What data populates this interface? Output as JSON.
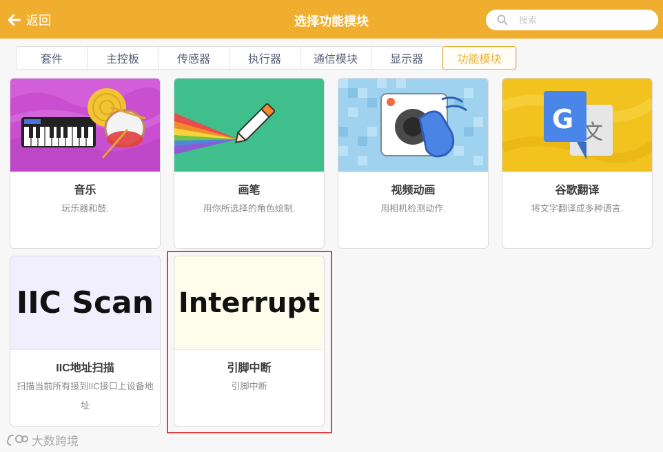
{
  "header": {
    "back_label": "返回",
    "title": "选择功能模块",
    "search_placeholder": "搜索"
  },
  "tabs": [
    {
      "label": "套件"
    },
    {
      "label": "主控板"
    },
    {
      "label": "传感器"
    },
    {
      "label": "执行器"
    },
    {
      "label": "通信模块"
    },
    {
      "label": "显示器"
    },
    {
      "label": "功能模块",
      "active": true
    }
  ],
  "cards": [
    {
      "name": "音乐",
      "desc": "玩乐器和鼓.",
      "icon": "music-piano-drum"
    },
    {
      "name": "画笔",
      "desc": "用你所选择的角色绘制.",
      "icon": "pen-rainbow"
    },
    {
      "name": "视频动画",
      "desc": "用相机检测动作.",
      "icon": "camera-hand"
    },
    {
      "name": "谷歌翻译",
      "desc": "将文字翻译成多种语言.",
      "icon": "google-translate"
    },
    {
      "name": "IIC地址扫描",
      "desc": "扫描当前所有接到IIC接口上设备地址",
      "image_text": "IIC Scan"
    },
    {
      "name": "引脚中断",
      "desc": "引脚中断",
      "image_text": "Interrupt",
      "selected": true
    }
  ],
  "watermark": "大数跨境",
  "colors": {
    "accent": "#f0ae2e",
    "highlight": "#d64541",
    "tab_active": "#f0ae2e"
  }
}
